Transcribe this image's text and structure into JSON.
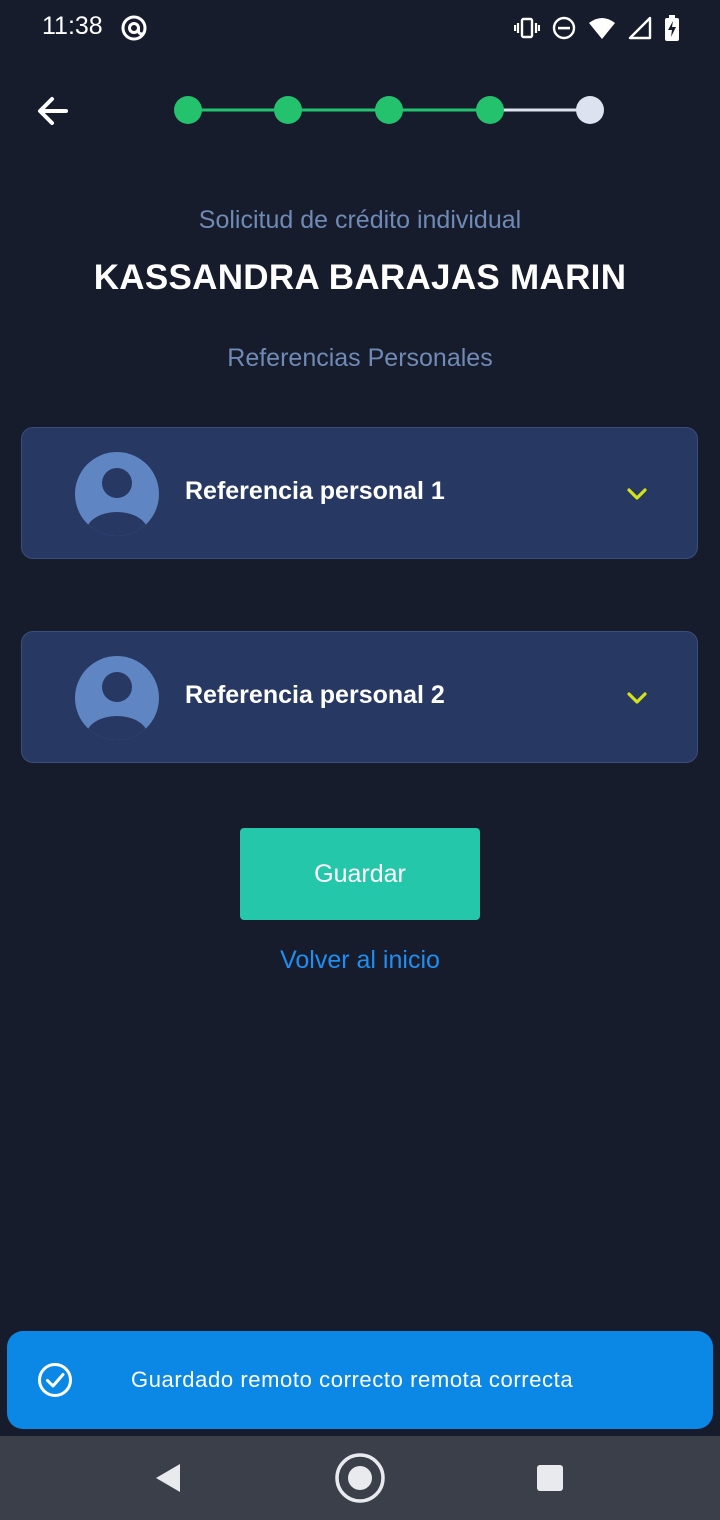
{
  "status_bar": {
    "time": "11:38",
    "icons": [
      "at-sign-icon",
      "vibrate-icon",
      "do-not-disturb-icon",
      "wifi-icon",
      "signal-icon",
      "battery-charging-icon"
    ]
  },
  "header": {
    "back_icon": "arrow-left-icon",
    "stepper": {
      "total_steps": 5,
      "completed_steps": 4,
      "completed_color": "#25c26e",
      "pending_color": "#dde2f0"
    }
  },
  "main": {
    "subtitle": "Solicitud de crédito individual",
    "client_name": "KASSANDRA BARAJAS MARIN",
    "section_title": "Referencias Personales",
    "references": [
      {
        "label": "Referencia personal 1",
        "icon": "user-avatar-icon",
        "expand_icon": "chevron-down-icon"
      },
      {
        "label": "Referencia personal 2",
        "icon": "user-avatar-icon",
        "expand_icon": "chevron-down-icon"
      }
    ],
    "save_label": "Guardar",
    "home_link": "Volver al inicio"
  },
  "toast": {
    "icon": "check-circle-icon",
    "message": "Guardado remoto correcto remota correcta"
  },
  "colors": {
    "background": "#171c2c",
    "card": "#273863",
    "accent": "#25c7aa",
    "link": "#1f8ef0",
    "chevron": "#d4e21a",
    "toast": "#0b88e6"
  }
}
